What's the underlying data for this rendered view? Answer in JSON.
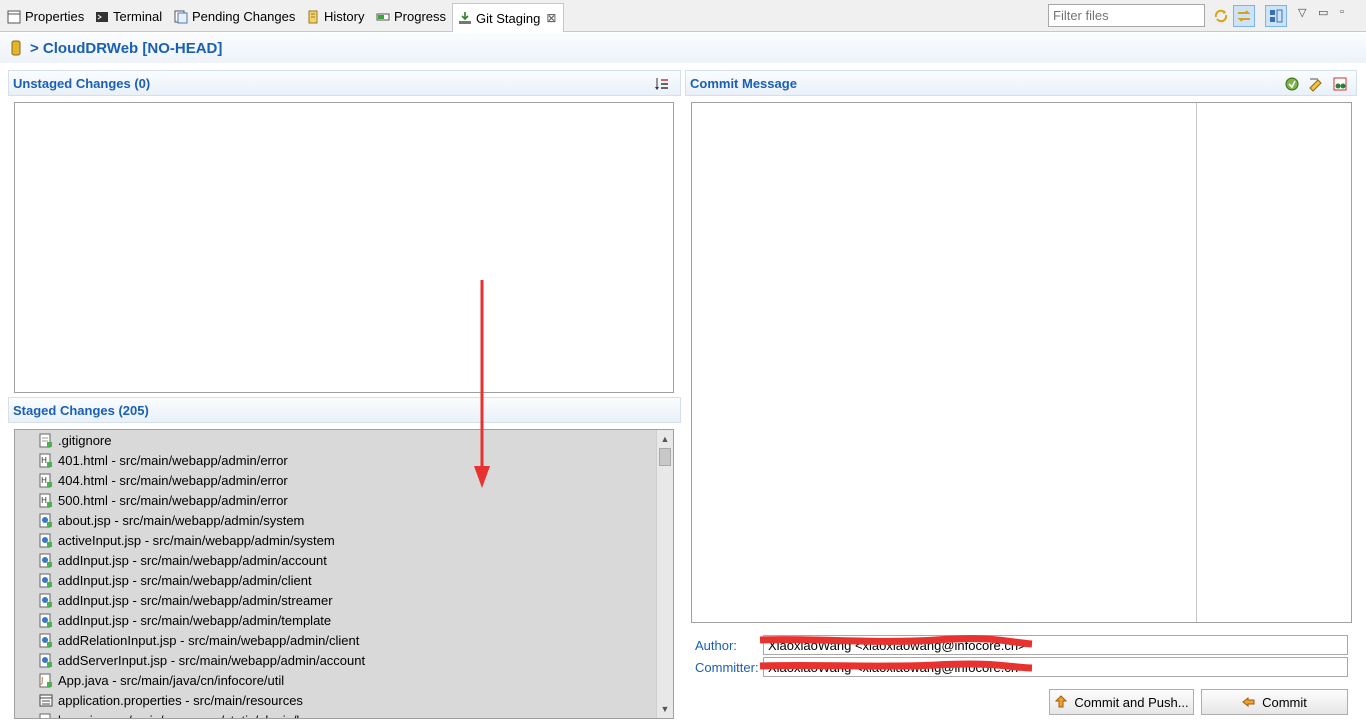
{
  "tabs": [
    {
      "label": "Properties",
      "icon": "properties-icon"
    },
    {
      "label": "Terminal",
      "icon": "terminal-icon"
    },
    {
      "label": "Pending Changes",
      "icon": "pending-changes-icon"
    },
    {
      "label": "History",
      "icon": "history-icon"
    },
    {
      "label": "Progress",
      "icon": "progress-icon"
    },
    {
      "label": "Git Staging",
      "icon": "git-staging-icon",
      "close": "⊠"
    }
  ],
  "filter": {
    "placeholder": "Filter files"
  },
  "repo": {
    "title": "> CloudDRWeb [NO-HEAD]"
  },
  "unstaged": {
    "title": "Unstaged Changes (0)"
  },
  "staged": {
    "title": "Staged Changes (205)",
    "files": [
      {
        "name": ".gitignore",
        "icon": "text-file-icon"
      },
      {
        "name": "401.html - src/main/webapp/admin/error",
        "icon": "html-file-icon"
      },
      {
        "name": "404.html - src/main/webapp/admin/error",
        "icon": "html-file-icon"
      },
      {
        "name": "500.html - src/main/webapp/admin/error",
        "icon": "html-file-icon"
      },
      {
        "name": "about.jsp - src/main/webapp/admin/system",
        "icon": "jsp-file-icon"
      },
      {
        "name": "activeInput.jsp - src/main/webapp/admin/system",
        "icon": "jsp-file-icon"
      },
      {
        "name": "addInput.jsp - src/main/webapp/admin/account",
        "icon": "jsp-file-icon"
      },
      {
        "name": "addInput.jsp - src/main/webapp/admin/client",
        "icon": "jsp-file-icon"
      },
      {
        "name": "addInput.jsp - src/main/webapp/admin/streamer",
        "icon": "jsp-file-icon"
      },
      {
        "name": "addInput.jsp - src/main/webapp/admin/template",
        "icon": "jsp-file-icon"
      },
      {
        "name": "addRelationInput.jsp - src/main/webapp/admin/client",
        "icon": "jsp-file-icon"
      },
      {
        "name": "addServerInput.jsp - src/main/webapp/admin/account",
        "icon": "jsp-file-icon"
      },
      {
        "name": "App.java - src/main/java/cn/infocore/util",
        "icon": "java-file-icon"
      },
      {
        "name": "application.properties - src/main/resources",
        "icon": "properties-file-icon"
      },
      {
        "name": "base.js - src/main/resources/static/plugin/base",
        "icon": "js-file-icon"
      }
    ]
  },
  "commit": {
    "title": "Commit Message",
    "author_label": "Author:",
    "author_value": "XiaoxiaoWang <xiaoxiaowang@infocore.cn>",
    "committer_label": "Committer:",
    "committer_value": "XiaoxiaoWang <xiaoxiaowang@infocore.cn>",
    "commit_push_label": "Commit and Push...",
    "commit_label": "Commit"
  },
  "colors": {
    "accent": "#1a5fb4",
    "annotation": "#e8322f"
  }
}
